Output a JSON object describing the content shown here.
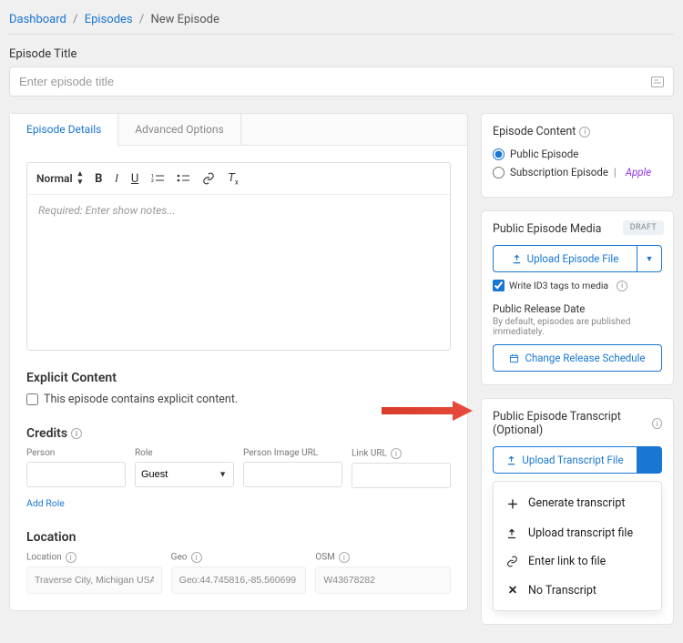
{
  "breadcrumb": {
    "dashboard": "Dashboard",
    "episodes": "Episodes",
    "current": "New Episode"
  },
  "title": {
    "label": "Episode Title",
    "placeholder": "Enter episode title"
  },
  "tabs": {
    "details": "Episode Details",
    "advanced": "Advanced Options"
  },
  "editor": {
    "style_label": "Normal",
    "placeholder": "Required: Enter show notes..."
  },
  "explicit": {
    "heading": "Explicit Content",
    "checkbox": "This episode contains explicit content."
  },
  "credits": {
    "heading": "Credits",
    "cols": {
      "person": "Person",
      "role": "Role",
      "image": "Person Image URL",
      "link": "Link URL"
    },
    "role_value": "Guest",
    "add_role": "Add Role"
  },
  "location": {
    "heading": "Location",
    "cols": {
      "location": "Location",
      "geo": "Geo",
      "osm": "OSM"
    },
    "values": {
      "location": "Traverse City, Michigan USA",
      "geo": "Geo:44.745816,-85.560699",
      "osm": "W43678282"
    }
  },
  "content_panel": {
    "heading": "Episode Content",
    "public": "Public Episode",
    "subscription": "Subscription Episode",
    "apple": "Apple"
  },
  "media_panel": {
    "heading": "Public Episode Media",
    "badge": "DRAFT",
    "upload_btn": "Upload Episode File",
    "id3": "Write ID3 tags to media",
    "release_heading": "Public Release Date",
    "release_desc": "By default, episodes are published immediately.",
    "schedule_btn": "Change Release Schedule"
  },
  "transcript_panel": {
    "heading": "Public Episode Transcript (Optional)",
    "upload_btn": "Upload Transcript File",
    "menu": {
      "generate": "Generate transcript",
      "upload": "Upload transcript file",
      "link": "Enter link to file",
      "none": "No Transcript"
    }
  }
}
